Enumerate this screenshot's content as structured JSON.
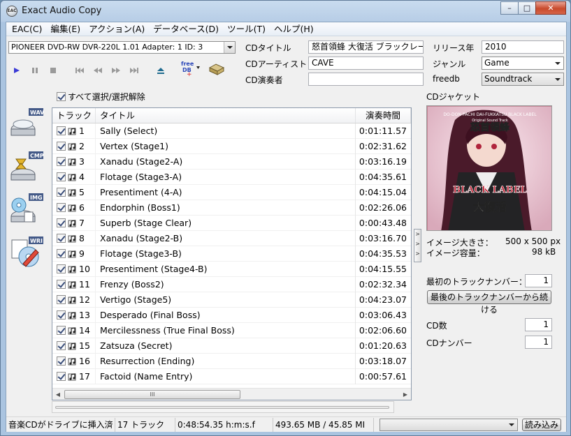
{
  "window": {
    "title": "Exact Audio Copy",
    "icon_text": "EAC",
    "minimize": "–",
    "maximize": "□",
    "close": "✕"
  },
  "menu": [
    "EAC(C)",
    "編集(E)",
    "アクション(A)",
    "データベース(D)",
    "ツール(T)",
    "ヘルプ(H)"
  ],
  "drive": {
    "selected": "PIONEER DVD-RW  DVR-220L 1.01   Adapter: 1  ID: 3"
  },
  "toolbar": {
    "freedb_label": "freedb"
  },
  "cd_info": {
    "title_label": "CDタイトル",
    "title_value": "怒首領蜂 大復活 ブラックレーベ",
    "artist_label": "CDアーティスト",
    "artist_value": "CAVE",
    "performer_label": "CD演奏者",
    "performer_value": "",
    "year_label": "リリース年",
    "year_value": "2010",
    "genre_label": "ジャンル",
    "genre_value": "Game",
    "freedb_label": "freedb",
    "freedb_value": "Soundtrack"
  },
  "select_all": {
    "label": "すべて選択/選択解除",
    "checked": true
  },
  "side_buttons": [
    "WAV",
    "CMP",
    "IMG",
    "WRI"
  ],
  "tracklist": {
    "headers": {
      "track": "トラック",
      "title": "タイトル",
      "time": "演奏時間"
    },
    "rows": [
      {
        "no": "1",
        "title": "Sally (Select)",
        "time": "0:01:11.57"
      },
      {
        "no": "2",
        "title": "Vertex (Stage1)",
        "time": "0:02:31.62"
      },
      {
        "no": "3",
        "title": "Xanadu (Stage2-A)",
        "time": "0:03:16.19"
      },
      {
        "no": "4",
        "title": "Flotage (Stage3-A)",
        "time": "0:04:35.61"
      },
      {
        "no": "5",
        "title": "Presentiment (4-A)",
        "time": "0:04:15.04"
      },
      {
        "no": "6",
        "title": "Endorphin (Boss1)",
        "time": "0:02:26.06"
      },
      {
        "no": "7",
        "title": "Superb (Stage Clear)",
        "time": "0:00:43.48"
      },
      {
        "no": "8",
        "title": "Xanadu (Stage2-B)",
        "time": "0:03:16.70"
      },
      {
        "no": "9",
        "title": "Flotage (Stage3-B)",
        "time": "0:04:35.53"
      },
      {
        "no": "10",
        "title": "Presentiment (Stage4-B)",
        "time": "0:04:15.55"
      },
      {
        "no": "11",
        "title": "Frenzy (Boss2)",
        "time": "0:02:32.34"
      },
      {
        "no": "12",
        "title": "Vertigo (Stage5)",
        "time": "0:04:23.07"
      },
      {
        "no": "13",
        "title": "Desperado (Final Boss)",
        "time": "0:03:06.43"
      },
      {
        "no": "14",
        "title": "Mercilessness (True Final Boss)",
        "time": "0:02:06.60"
      },
      {
        "no": "15",
        "title": "Zatsuza (Secret)",
        "time": "0:01:20.63"
      },
      {
        "no": "16",
        "title": "Resurrection (Ending)",
        "time": "0:03:18.07"
      },
      {
        "no": "17",
        "title": "Factoid (Name Entry)",
        "time": "0:00:57.61"
      }
    ]
  },
  "scrollbar_grip": "III",
  "cover": {
    "label": "CDジャケット",
    "art_line1": "DO-DON-PACHI DAI-FUKKATSU BLACK LABEL",
    "art_line2": "Original Sound Track",
    "art_logo": "BLACK LABEL",
    "size_label": "イメージ大きさ：",
    "size_value": "500 x 500 px",
    "bytes_label": "イメージ容量：",
    "bytes_value": "98 kB"
  },
  "numbering": {
    "first_track_label": "最初のトラックナンバー：",
    "first_track_value": "1",
    "continue_button": "最後のトラックナンバーから続ける",
    "cd_count_label": "CD数",
    "cd_count_value": "1",
    "cd_number_label": "CDナンバー",
    "cd_number_value": "1"
  },
  "status": {
    "inserted": "音楽CDがドライブに挿入済",
    "tracks": "17 トラック",
    "length": "0:48:54.35 h:m:s.f",
    "size": "493.65 MB / 45.85 MI",
    "action_dropdown": "",
    "load_button": "読み込み"
  },
  "colors": {
    "accent": "#3a3ad0",
    "title_bar": "#b7cde6"
  }
}
